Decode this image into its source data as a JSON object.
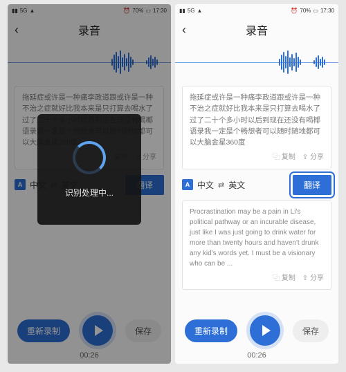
{
  "status": {
    "carrier": "5G",
    "alarm_icon": "⏰",
    "battery_pct": "70%",
    "time": "17:30"
  },
  "header": {
    "title": "录音"
  },
  "transcription_cn": "拖延症或许是一种痛李政道跟或许是一种不治之症就好比我本来是只打算去喝水了过了二十个多小时以后到现在还没有喝椰语录我一定是个畅想者可以随时随地都可以大脑金星360度",
  "actions": {
    "copy": "⿻ 复制",
    "share": "⇪ 分享"
  },
  "lang": {
    "badge": "A",
    "src": "中文",
    "dst": "英文",
    "translate_btn": "翻译"
  },
  "translation_en": "Procrastination may be a pain in Li's political pathway or an incurable disease, just like I was just going to drink water for more than twenty hours and haven't drunk any kid's words yet. I must be a visionary who can be ...",
  "controls": {
    "rerecord": "重新录制",
    "save": "保存",
    "time": "00:26"
  },
  "modal": {
    "text": "识别处理中..."
  }
}
